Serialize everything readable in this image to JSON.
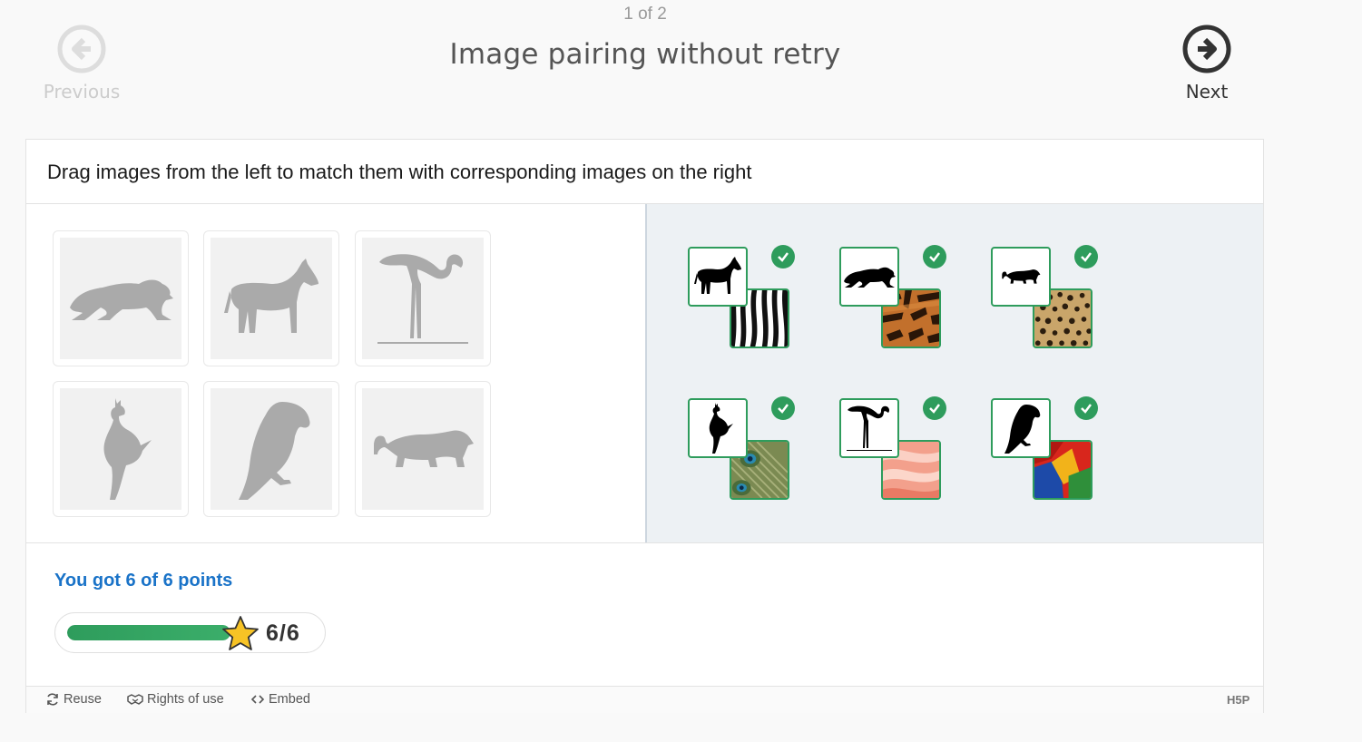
{
  "header": {
    "page_counter": "1 of 2",
    "title": "Image pairing without retry",
    "previous_label": "Previous",
    "next_label": "Next"
  },
  "task": {
    "instruction": "Drag images from the left to match them with corresponding images on the right",
    "source_cards": [
      {
        "animal": "tiger"
      },
      {
        "animal": "zebra"
      },
      {
        "animal": "flamingo"
      },
      {
        "animal": "peacock"
      },
      {
        "animal": "parrot"
      },
      {
        "animal": "leopard"
      }
    ],
    "matched_pairs": [
      {
        "animal": "zebra",
        "texture": "zebra-stripes",
        "correct": true
      },
      {
        "animal": "tiger",
        "texture": "tiger-fur",
        "correct": true
      },
      {
        "animal": "leopard",
        "texture": "leopard-spots",
        "correct": true
      },
      {
        "animal": "peacock",
        "texture": "peacock-feathers",
        "correct": true
      },
      {
        "animal": "flamingo",
        "texture": "flamingo-feathers",
        "correct": true
      },
      {
        "animal": "parrot",
        "texture": "parrot-feathers",
        "correct": true
      }
    ]
  },
  "result": {
    "feedback": "You got 6 of 6 points",
    "score_text": "6/6",
    "progress_fraction": 1.0
  },
  "footer": {
    "reuse_label": "Reuse",
    "rights_label": "Rights of use",
    "embed_label": "Embed",
    "logo_text": "H5P"
  },
  "colors": {
    "correct": "#2e9c5c",
    "feedback": "#1a73c8",
    "silhouette_disabled": "#aaaaaa",
    "right_pane_bg": "#edf1f4"
  }
}
